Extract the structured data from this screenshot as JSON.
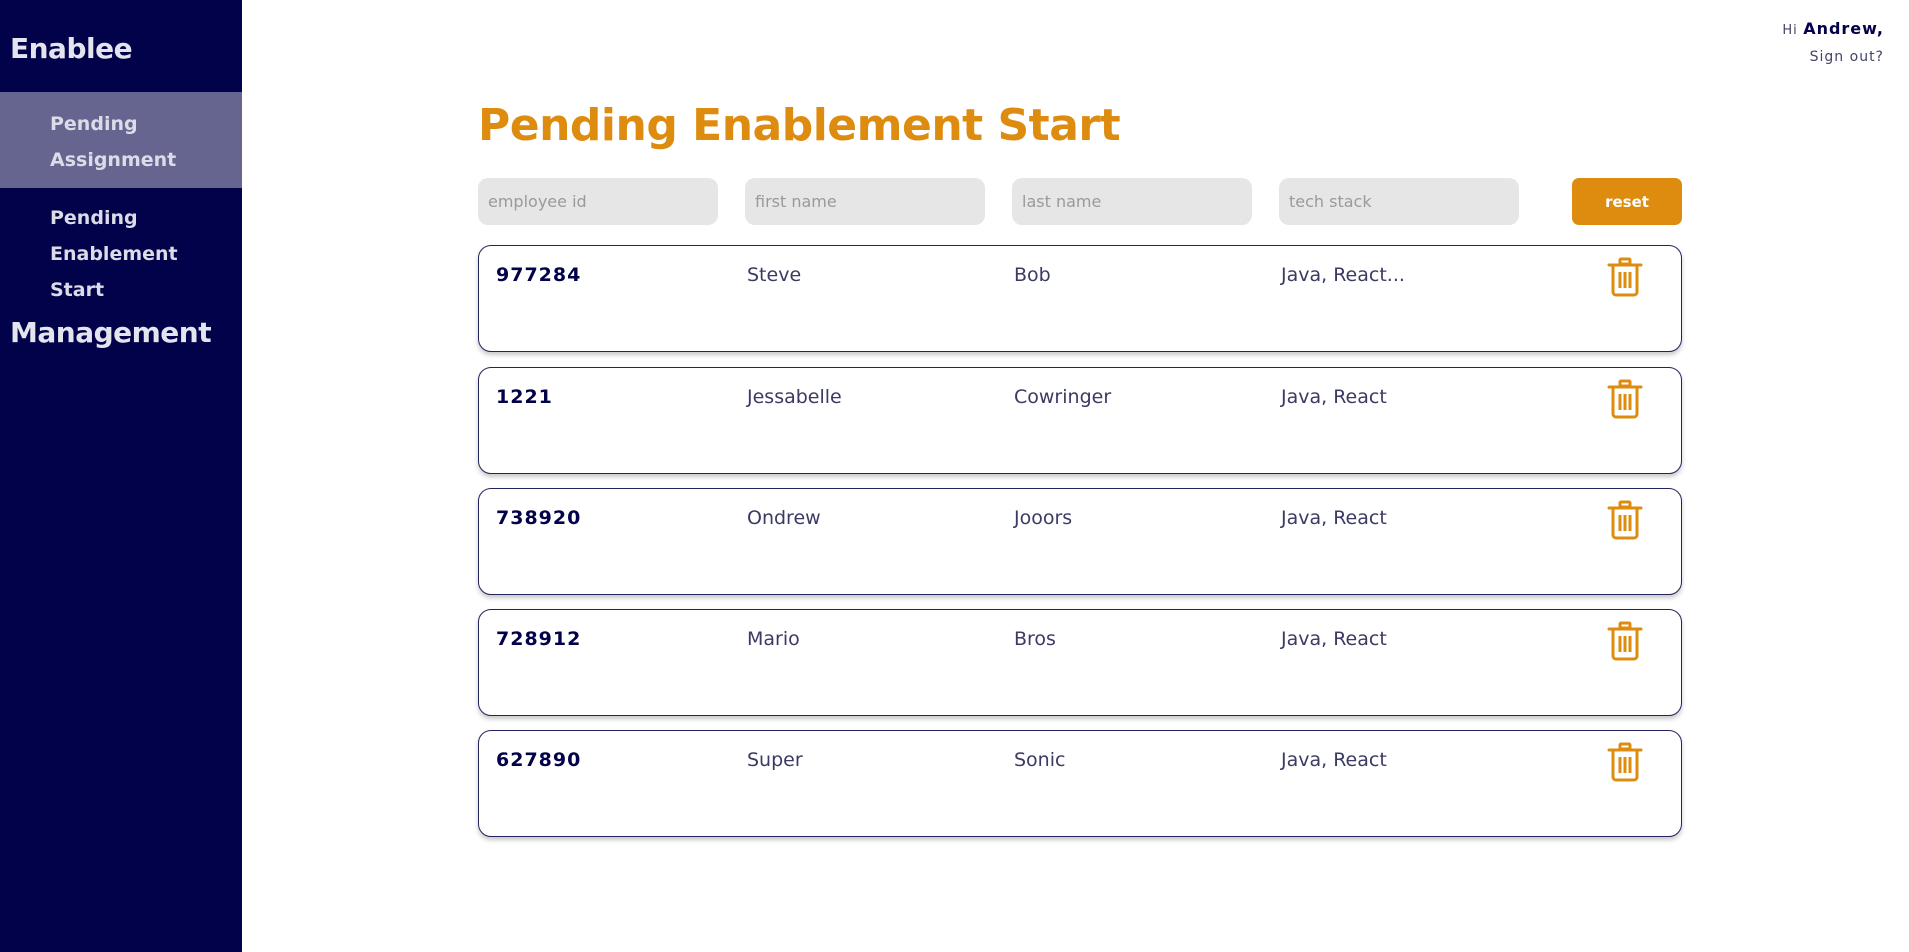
{
  "sidebar": {
    "brand": "Enablee",
    "items": [
      {
        "label_line1": "Pending",
        "label_line2": "Assignment"
      },
      {
        "label_line1": "Pending",
        "label_line2": "Enablement Start"
      }
    ],
    "management": "Management"
  },
  "user": {
    "greeting": "Hi",
    "name": "Andrew,",
    "signout": "Sign out?"
  },
  "page": {
    "title": "Pending Enablement Start"
  },
  "filters": {
    "employee_id_placeholder": "employee id",
    "first_name_placeholder": "first name",
    "last_name_placeholder": "last name",
    "tech_stack_placeholder": "tech stack",
    "reset_label": "reset"
  },
  "rows": [
    {
      "id": "977284",
      "first": "Steve",
      "last": "Bob",
      "tech": "Java, React..."
    },
    {
      "id": "1221",
      "first": "Jessabelle",
      "last": "Cowringer",
      "tech": "Java, React"
    },
    {
      "id": "738920",
      "first": "Ondrew",
      "last": "Jooors",
      "tech": "Java, React"
    },
    {
      "id": "728912",
      "first": "Mario",
      "last": "Bros",
      "tech": "Java, React"
    },
    {
      "id": "627890",
      "first": "Super",
      "last": "Sonic",
      "tech": "Java, React"
    }
  ],
  "icons": {
    "delete": "trash-icon"
  },
  "colors": {
    "sidebar_bg": "#02024a",
    "sidebar_active": "#65658f",
    "accent": "#de8c0f",
    "input_bg": "#e5e6e5",
    "row_border": "#24245e"
  }
}
